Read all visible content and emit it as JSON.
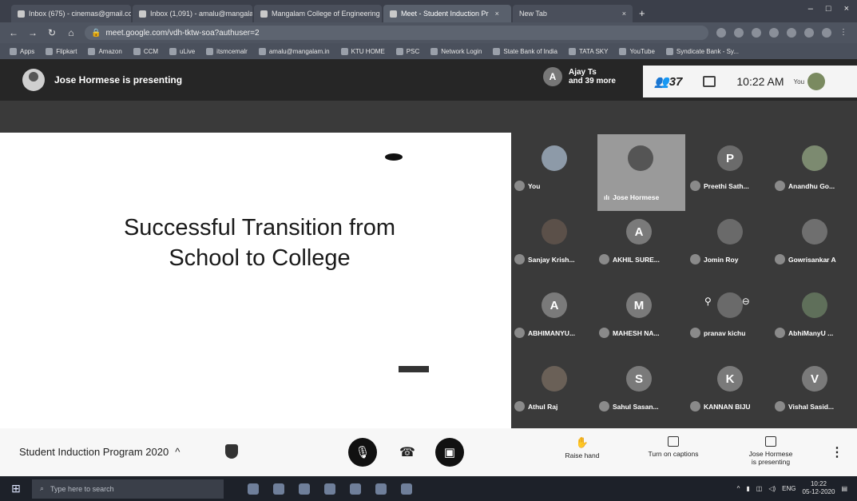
{
  "browser": {
    "tabs": [
      {
        "label": "Inbox (675) - cinemas@gmail.com",
        "active": false
      },
      {
        "label": "Inbox (1,091) - amalu@mangalam",
        "active": false
      },
      {
        "label": "Mangalam College of Engineering",
        "active": false
      },
      {
        "label": "Meet - Student Induction Pr",
        "active": true
      },
      {
        "label": "New Tab",
        "active": false
      }
    ],
    "address": "meet.google.com/vdh-tktw-soa?authuser=2",
    "bookmarks": [
      "Apps",
      "Flipkart",
      "Amazon",
      "CCM",
      "uLive",
      "itsmcemalr",
      "amalu@mangalam.in",
      "KTU HOME",
      "PSC",
      "Network Login",
      "State Bank of India",
      "TATA SKY",
      "YouTube",
      "Syndicate Bank - Sy..."
    ]
  },
  "meet": {
    "presenting_text": "Jose Hormese is presenting",
    "participants_chip": {
      "initial": "A",
      "line1": "Ajay Ts",
      "line2": "and 39 more"
    },
    "participant_count": "37",
    "time": "10:22 AM",
    "you_label": "You",
    "slide": {
      "title_line1": "Successful Transition from",
      "title_line2": "School to College"
    },
    "participants": [
      {
        "name": "You",
        "initial": "",
        "color": "#8d9aa8"
      },
      {
        "name": "Jose Hormese",
        "initial": "",
        "color": "#555555"
      },
      {
        "name": "Preethi Sath...",
        "initial": "P",
        "color": "#6b6b6b"
      },
      {
        "name": "Anandhu Go...",
        "initial": "",
        "color": "#7c8a70"
      },
      {
        "name": "Sanjay Krish...",
        "initial": "",
        "color": "#5b5049"
      },
      {
        "name": "AKHIL SURE...",
        "initial": "A",
        "color": "#7a7a7a"
      },
      {
        "name": "Jomin Roy",
        "initial": "",
        "color": "#6a6a6a"
      },
      {
        "name": "Gowrisankar A",
        "initial": "",
        "color": "#6f6f6f"
      },
      {
        "name": "ABHIMANYU...",
        "initial": "A",
        "color": "#7a7a7a"
      },
      {
        "name": "MAHESH NA...",
        "initial": "M",
        "color": "#7a7a7a"
      },
      {
        "name": "pranav kichu",
        "initial": "",
        "color": "#6a6a6a"
      },
      {
        "name": "AbhiManyU ...",
        "initial": "",
        "color": "#5f6f5a"
      },
      {
        "name": "Athul Raj",
        "initial": "",
        "color": "#6a6057"
      },
      {
        "name": "Sahul Sasan...",
        "initial": "S",
        "color": "#7a7a7a"
      },
      {
        "name": "KANNAN BIJU",
        "initial": "K",
        "color": "#7a7a7a"
      },
      {
        "name": "Vishal Sasid...",
        "initial": "V",
        "color": "#7a7a7a"
      }
    ],
    "bottom": {
      "meeting_title": "Student Induction Program 2020",
      "raise_hand": "Raise hand",
      "captions": "Turn on captions",
      "presenting_line1": "Jose Hormese",
      "presenting_line2": "is presenting"
    }
  },
  "taskbar": {
    "search_placeholder": "Type here to search",
    "lang": "ENG",
    "time": "10:22",
    "date": "05-12-2020"
  }
}
